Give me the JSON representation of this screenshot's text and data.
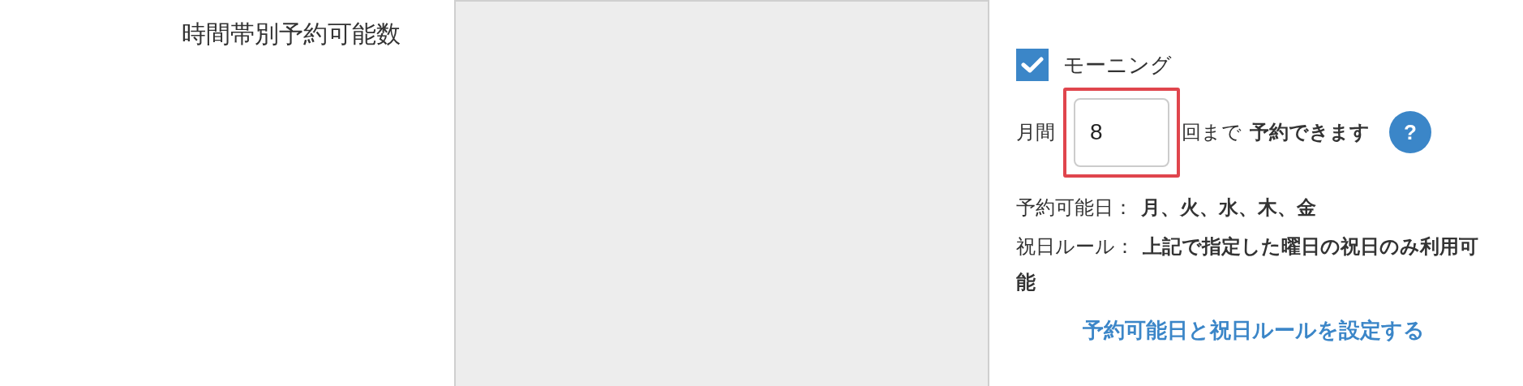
{
  "label": "時間帯別予約可能数",
  "option": {
    "label": "モーニング",
    "checked": true
  },
  "limit": {
    "prefix": "月間",
    "value": "8",
    "highlighted": true,
    "suffix": "回まで",
    "suffix_bold": "予約できます",
    "help": "?"
  },
  "details": [
    {
      "term": "予約可能日：",
      "value": "月、火、水、木、金"
    },
    {
      "term": "祝日ルール：",
      "value": "上記で指定した曜日の祝日のみ利用可能"
    }
  ],
  "link": "予約可能日と祝日ルールを設定する"
}
